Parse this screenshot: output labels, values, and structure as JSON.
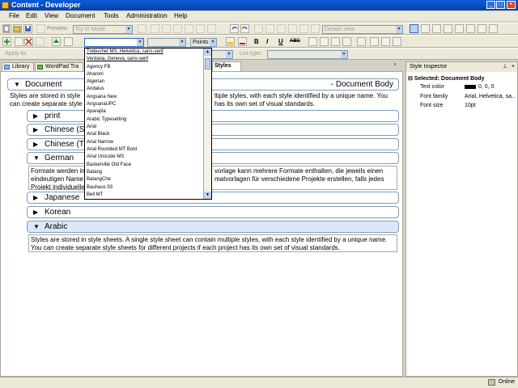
{
  "window": {
    "title": "Content - Developer"
  },
  "menu": [
    "File",
    "Edit",
    "View",
    "Document",
    "Tools",
    "Administration",
    "Help"
  ],
  "toolbar1": {
    "preview_label": "Preview",
    "tryit_value": "Try It! Mode",
    "view_value": "Details view"
  },
  "toolbar2": {
    "font_value": "",
    "size_unit": "Points",
    "bold": "B",
    "italic": "I",
    "underline": "U",
    "strike": "ABC"
  },
  "toolbar3": {
    "apply_to_label": "Apply to:",
    "list_type_label": "List type:"
  },
  "tabs": [
    {
      "label": "Library"
    },
    {
      "label": "WordPad Tra"
    },
    {
      "label": "Styles"
    }
  ],
  "document": {
    "root_label": "Document",
    "root_right_label": "- Document Body",
    "intro_para_left": "Styles are stored in style\ncan create separate style",
    "intro_para_right": "ltiple styles, with each style identified by a unique name. You\nhas its own set of visual standards.",
    "sections": [
      {
        "label": "print",
        "expanded": false
      },
      {
        "label": "Chinese (S",
        "expanded": false
      },
      {
        "label": "Chinese (T",
        "expanded": false
      },
      {
        "label": "German",
        "expanded": true
      },
      {
        "label": "Japanese",
        "expanded": false
      },
      {
        "label": "Korean",
        "expanded": false
      },
      {
        "label": "Arabic",
        "expanded": true
      }
    ],
    "german_para_left": "Formate werden in\neindeutigen Name\nProjekt individuelle",
    "german_para_right": "vorlage kann mehrere Formate enthalten, die jeweils einen\nmatvorlagen für verschiedene Projekte erstellen, falls jedes",
    "arabic_para": "Styles are stored in style sheets. A single style sheet can contain multiple styles, with each style identified by a unique name. You can create separate style sheets for different projects if each project has its own set of visual standards."
  },
  "font_dropdown": {
    "recent": [
      "Trebuchet MS, Helvetica, sans-serif",
      "Verdana, Geneva, sans-serif"
    ],
    "items": [
      "Agency FB",
      "Aharoni",
      "Algerian",
      "Andalus",
      "Angsana New",
      "AngsanaUPC",
      "Aparajita",
      "Arabic Typesetting",
      "Arial",
      "Arial Black",
      "Arial Narrow",
      "Arial Rounded MT Bold",
      "Arial Unicode MS",
      "Baskerville Old Face",
      "Batang",
      "BatangChe",
      "Bauhaus 93",
      "Bell MT"
    ]
  },
  "inspector": {
    "title": "Style Inspector",
    "selected": "Selected: Document Body",
    "props": [
      {
        "name": "Text color",
        "value": "0, 0, 0"
      },
      {
        "name": "Font family",
        "value": "Arial, Helvetica, sa..."
      },
      {
        "name": "Font size",
        "value": "10pt"
      }
    ]
  },
  "status": {
    "online": "Online"
  },
  "colors": {
    "accent": "#316ac5",
    "titlebar": "#0a5cd8",
    "chrome": "#ece9d8"
  }
}
